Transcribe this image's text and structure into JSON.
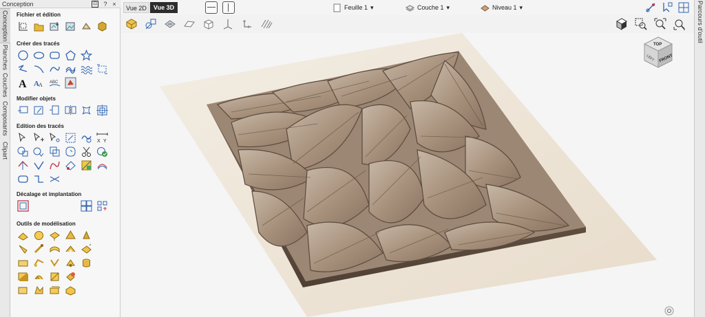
{
  "panel": {
    "title": "Conception",
    "pin": "⊡",
    "help": "?",
    "close": "×"
  },
  "left_tabs": [
    "Conception",
    "Planches",
    "Couches",
    "Composants",
    "Clipart"
  ],
  "right_tabs": [
    "Parcours d'outil"
  ],
  "sections": {
    "file": "Fichier et édition",
    "create": "Créer des tracés",
    "modify": "Modifier objets",
    "edit": "Edition des tracés",
    "offset": "Décalage et implantation",
    "modeling": "Outils de modélisation"
  },
  "view_tabs": {
    "tab_2d": "Vue 2D",
    "tab_3d": "Vue 3D"
  },
  "dropdowns": {
    "sheet": "Feuille 1",
    "layer": "Couche 1",
    "level": "Niveau 1"
  },
  "view_cube": {
    "top": "TOP",
    "left": "LEFT",
    "front": "FRONT"
  },
  "colors": {
    "accent_dark": "#2d2d2d",
    "wood": "#b0a090",
    "material_sheet": "#efe8dc"
  }
}
